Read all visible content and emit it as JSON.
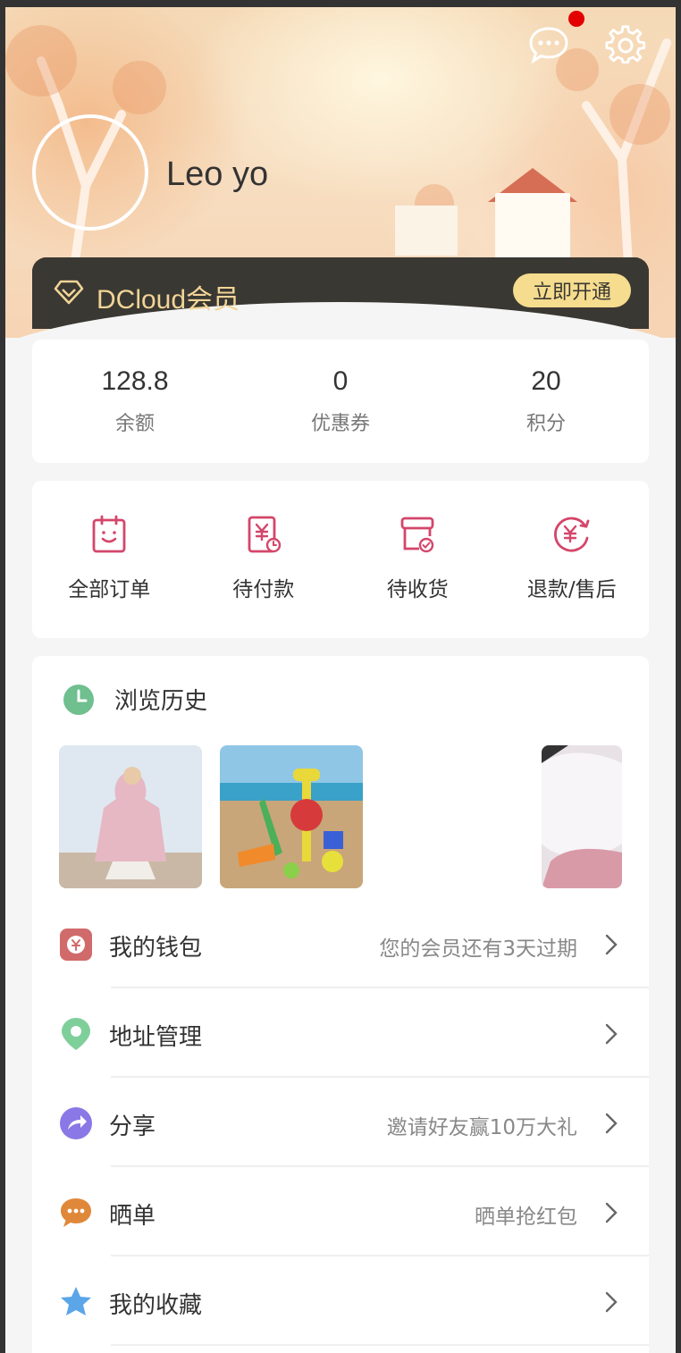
{
  "header": {
    "username": "Leo yo",
    "messages_icon": "chat-bubble-icon",
    "settings_icon": "gear-icon",
    "has_unread": true
  },
  "vip": {
    "label": "DCloud会员",
    "button": "立即开通",
    "icon": "diamond-icon"
  },
  "stats": [
    {
      "value": "128.8",
      "label": "余额"
    },
    {
      "value": "0",
      "label": "优惠券"
    },
    {
      "value": "20",
      "label": "积分"
    }
  ],
  "orders": [
    {
      "label": "全部订单",
      "icon": "clipboard-icon"
    },
    {
      "label": "待付款",
      "icon": "yen-bill-icon"
    },
    {
      "label": "待收货",
      "icon": "package-check-icon"
    },
    {
      "label": "退款/售后",
      "icon": "refund-yen-icon"
    }
  ],
  "history": {
    "title": "浏览历史",
    "icon": "clock-icon"
  },
  "menu": [
    {
      "label": "我的钱包",
      "note": "您的会员还有3天过期",
      "icon": "wallet-icon"
    },
    {
      "label": "地址管理",
      "note": "",
      "icon": "location-pin-icon"
    },
    {
      "label": "分享",
      "note": "邀请好友赢10万大礼",
      "icon": "share-icon"
    },
    {
      "label": "晒单",
      "note": "晒单抢红包",
      "icon": "comment-icon"
    },
    {
      "label": "我的收藏",
      "note": "",
      "icon": "star-icon"
    }
  ],
  "colors": {
    "accent_red": "#d4466a",
    "vip_gold": "#f1d496",
    "vip_dark": "#3a3833",
    "history_green": "#6fbf8f"
  }
}
